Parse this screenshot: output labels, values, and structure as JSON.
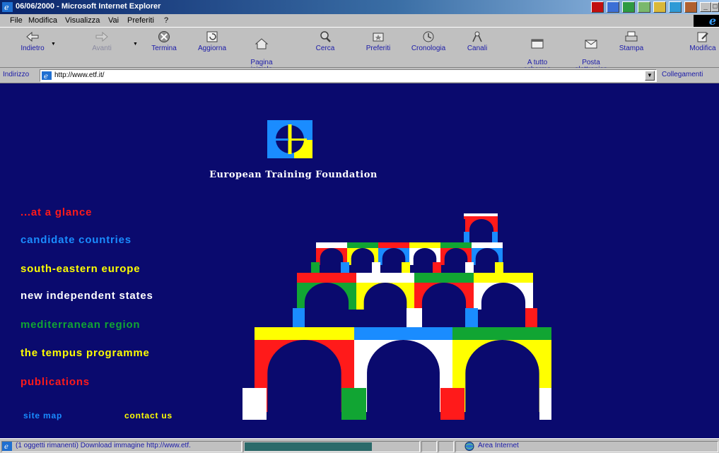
{
  "window": {
    "title": "06/06/2000 - Microsoft Internet Explorer",
    "min": "_",
    "max": "□",
    "close": "×"
  },
  "menu": [
    "File",
    "Modifica",
    "Visualizza",
    "Vai",
    "Preferiti",
    "?"
  ],
  "toolbar": [
    {
      "label": "Indietro",
      "icon": "back-arrow-icon"
    },
    {
      "label": "Avanti",
      "icon": "forward-arrow-icon"
    },
    {
      "label": "Termina",
      "icon": "stop-icon"
    },
    {
      "label": "Aggiorna",
      "icon": "refresh-icon"
    },
    {
      "label": "Pagina\niniziale",
      "icon": "home-icon"
    },
    {
      "label": "Cerca",
      "icon": "search-icon"
    },
    {
      "label": "Preferiti",
      "icon": "favorites-icon"
    },
    {
      "label": "Cronologia",
      "icon": "history-icon"
    },
    {
      "label": "Canali",
      "icon": "channels-icon"
    },
    {
      "label": "A tutto\nschermo",
      "icon": "fullscreen-icon"
    },
    {
      "label": "Posta\nelettronica",
      "icon": "mail-icon"
    },
    {
      "label": "Stampa",
      "icon": "print-icon"
    },
    {
      "label": "Modifica",
      "icon": "edit-icon"
    }
  ],
  "address": {
    "label": "Indirizzo",
    "value": "http://www.etf.it/",
    "links": "Collegamenti"
  },
  "page": {
    "org_name": "European Training Foundation",
    "nav": [
      {
        "label": "...at a glance",
        "color": "#ff1a1a"
      },
      {
        "label": "candidate countries",
        "color": "#1a8cff"
      },
      {
        "label": "south-eastern europe",
        "color": "#ffff00"
      },
      {
        "label": "new independent states",
        "color": "#ffffff"
      },
      {
        "label": "mediterranean region",
        "color": "#11a533"
      },
      {
        "label": "the tempus programme",
        "color": "#ffff00"
      },
      {
        "label": "publications",
        "color": "#ff1a1a"
      }
    ],
    "footer": [
      {
        "label": "site map",
        "color": "#1a8cff"
      },
      {
        "label": "contact us",
        "color": "#ffff00"
      }
    ],
    "colors": {
      "background": "#0a0a6e",
      "red": "#ff1a1a",
      "green": "#11a533",
      "blue": "#1a8cff",
      "yellow": "#ffff00",
      "white": "#ffffff"
    }
  },
  "status": {
    "message": "(1 oggetti rimanenti) Download immagine http://www.etf.",
    "zone": "Area Internet"
  }
}
